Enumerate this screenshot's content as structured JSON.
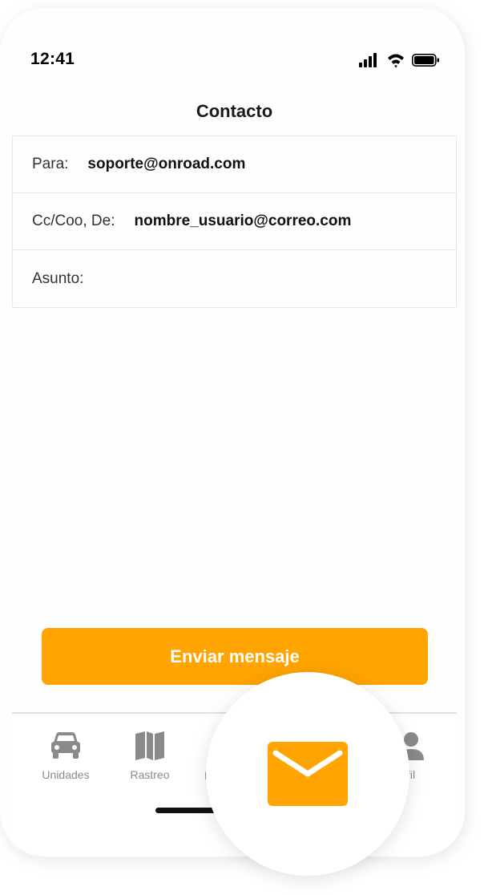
{
  "status_bar": {
    "time": "12:41"
  },
  "screen": {
    "title": "Contacto"
  },
  "form": {
    "to_label": "Para:",
    "to_value": "soporte@onroad.com",
    "from_label": "Cc/Coo, De:",
    "from_value": "nombre_usuario@correo.com",
    "subject_label": "Asunto:",
    "subject_value": ""
  },
  "actions": {
    "send_label": "Enviar mensaje"
  },
  "tab_bar": {
    "items": [
      {
        "label": "Unidades",
        "icon": "car-icon"
      },
      {
        "label": "Rastreo",
        "icon": "map-icon"
      },
      {
        "label": "N",
        "icon": "envelope-icon"
      },
      {
        "label": "fil",
        "icon": "person-icon"
      }
    ]
  },
  "colors": {
    "accent": "#FFA400",
    "tab_inactive": "#8A8A8A",
    "divider": "#E6E6E6"
  }
}
